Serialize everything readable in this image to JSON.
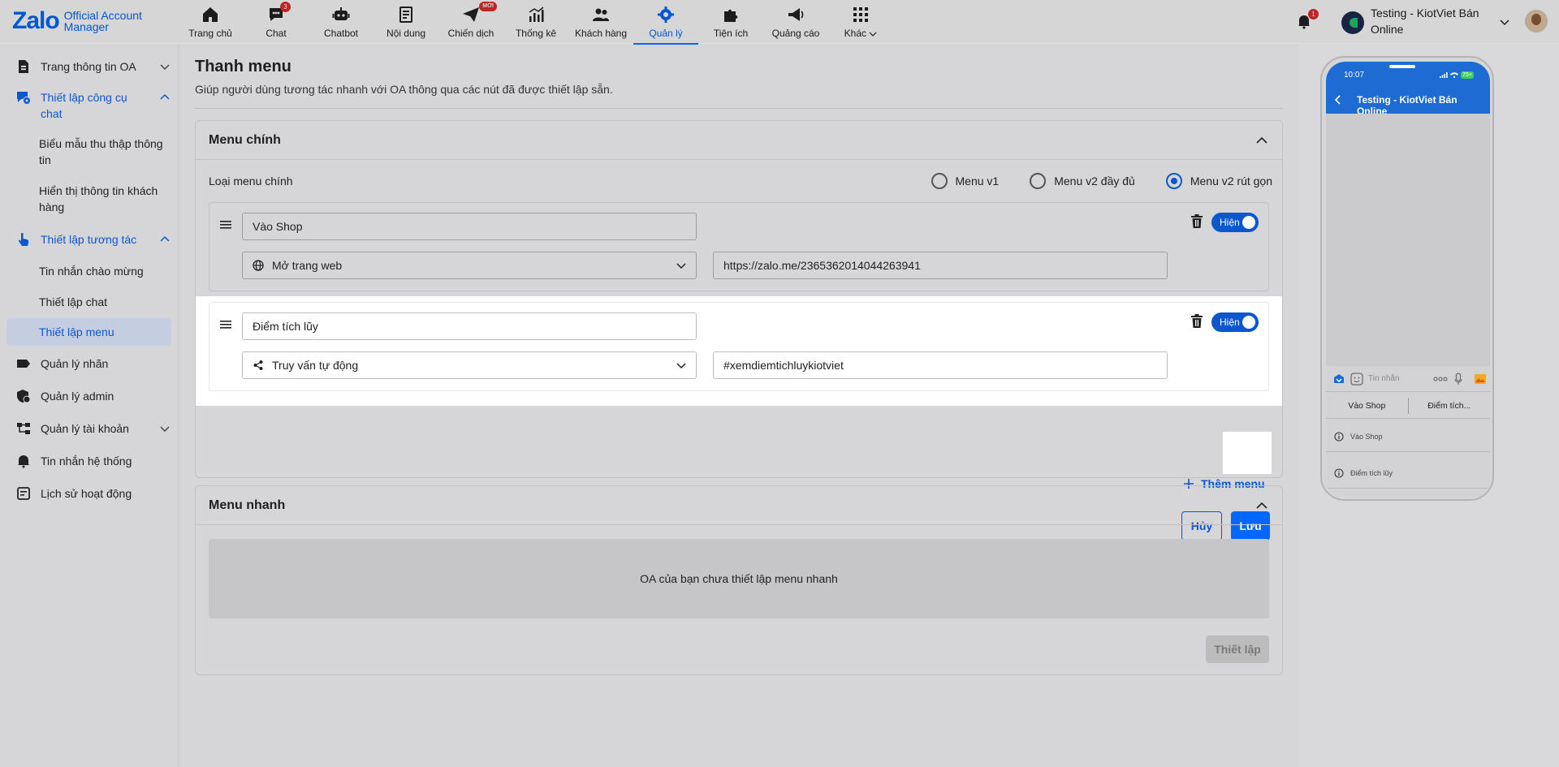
{
  "brand": {
    "logo": "Zalo",
    "product_line1": "Official Account",
    "product_line2": "Manager"
  },
  "topnav": [
    {
      "label": "Trang chủ",
      "icon": "home-icon"
    },
    {
      "label": "Chat",
      "icon": "chat-icon",
      "badge": "3"
    },
    {
      "label": "Chatbot",
      "icon": "robot-icon"
    },
    {
      "label": "Nội dung",
      "icon": "article-icon"
    },
    {
      "label": "Chiến dịch",
      "icon": "send-icon",
      "badge": "MỚI"
    },
    {
      "label": "Thống kê",
      "icon": "chart-icon"
    },
    {
      "label": "Khách hàng",
      "icon": "users-icon"
    },
    {
      "label": "Quản lý",
      "icon": "gear-icon",
      "active": true
    },
    {
      "label": "Tiện ích",
      "icon": "puzzle-icon"
    },
    {
      "label": "Quảng cáo",
      "icon": "megaphone-icon"
    },
    {
      "label": "Khác",
      "icon": "grid-icon"
    }
  ],
  "notifications": {
    "count": "1"
  },
  "account": {
    "name": "Testing - KiotViet Bán Online"
  },
  "sidebar": {
    "items": [
      {
        "label": "Trang thông tin OA"
      },
      {
        "label": "Thiết lập công cụ chat"
      },
      {
        "label": "Biểu mẫu thu thập thông tin"
      },
      {
        "label": "Hiển thị thông tin khách hàng"
      },
      {
        "label": "Thiết lập tương tác"
      },
      {
        "label": "Tin nhắn chào mừng"
      },
      {
        "label": "Thiết lập chat"
      },
      {
        "label": "Thiết lập menu"
      },
      {
        "label": "Quản lý nhãn"
      },
      {
        "label": "Quản lý admin"
      },
      {
        "label": "Quản lý tài khoản"
      },
      {
        "label": "Tin nhắn hệ thống"
      },
      {
        "label": "Lịch sử hoạt động"
      }
    ]
  },
  "page": {
    "title": "Thanh menu",
    "subtitle": "Giúp người dùng tương tác nhanh với OA thông qua các nút đã được thiết lập sẵn."
  },
  "main_menu": {
    "title": "Menu chính",
    "type_label": "Loại menu chính",
    "options": [
      "Menu v1",
      "Menu v2 đầy đủ",
      "Menu v2 rút gọn"
    ],
    "selected": "Menu v2 rút gọn",
    "items": [
      {
        "name": "Vào Shop",
        "action": "Mở trang web",
        "value": "https://zalo.me/2365362014044263941",
        "visible_label": "Hiện"
      },
      {
        "name": "Điểm tích lũy",
        "action": "Truy vấn tự động",
        "value": "#xemdiemtichluykiotviet",
        "visible_label": "Hiện"
      }
    ],
    "add_label": "Thêm menu",
    "cancel_label": "Hủy",
    "save_label": "Lưu"
  },
  "quick_menu": {
    "title": "Menu nhanh",
    "empty_text": "OA của bạn chưa thiết lập menu nhanh",
    "setup_label": "Thiết lập"
  },
  "preview": {
    "time": "10:07",
    "battery": "75+",
    "title": "Testing - KiotViet Bán Online",
    "input_placeholder": "Tin nhắn",
    "quick_buttons": [
      "Vào Shop",
      "Điểm tích..."
    ],
    "menu_list": [
      "Vào Shop",
      "Điểm tích lũy"
    ]
  },
  "colors": {
    "accent": "#0068ff",
    "link": "#0b57d0",
    "badge": "#e42d2d"
  }
}
